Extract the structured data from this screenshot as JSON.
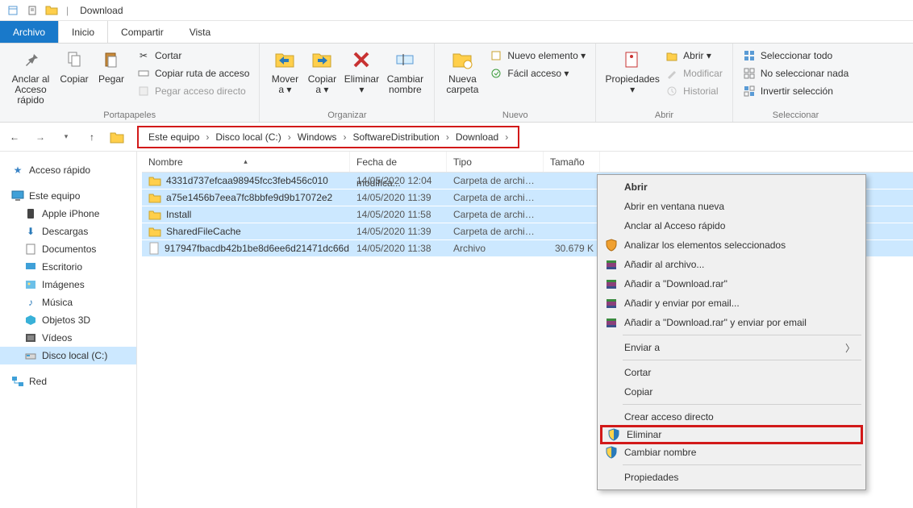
{
  "title": "Download",
  "tabs": {
    "file": "Archivo",
    "home": "Inicio",
    "share": "Compartir",
    "view": "Vista"
  },
  "ribbon": {
    "clipboard": {
      "pin": "Anclar al\nAcceso rápido",
      "copy": "Copiar",
      "paste": "Pegar",
      "cut": "Cortar",
      "copypath": "Copiar ruta de acceso",
      "pasteshortcut": "Pegar acceso directo",
      "label": "Portapapeles"
    },
    "organize": {
      "moveto": "Mover\na ▾",
      "copyto": "Copiar\na ▾",
      "delete": "Eliminar\n▾",
      "rename": "Cambiar\nnombre",
      "label": "Organizar"
    },
    "new": {
      "newfolder": "Nueva\ncarpeta",
      "newitem": "Nuevo elemento ▾",
      "easyaccess": "Fácil acceso ▾",
      "label": "Nuevo"
    },
    "open": {
      "properties": "Propiedades\n▾",
      "open": "Abrir ▾",
      "edit": "Modificar",
      "history": "Historial",
      "label": "Abrir"
    },
    "select": {
      "selectall": "Seleccionar todo",
      "selectnone": "No seleccionar nada",
      "invert": "Invertir selección",
      "label": "Seleccionar"
    }
  },
  "breadcrumb": [
    "Este equipo",
    "Disco local (C:)",
    "Windows",
    "SoftwareDistribution",
    "Download"
  ],
  "sidebar": {
    "quick": "Acceso rápido",
    "thispc": "Este equipo",
    "items": [
      "Apple iPhone",
      "Descargas",
      "Documentos",
      "Escritorio",
      "Imágenes",
      "Música",
      "Objetos 3D",
      "Vídeos",
      "Disco local (C:)"
    ],
    "network": "Red"
  },
  "columns": {
    "name": "Nombre",
    "date": "Fecha de modifica...",
    "type": "Tipo",
    "size": "Tamaño"
  },
  "rows": [
    {
      "name": "4331d737efcaa98945fcc3feb456c010",
      "date": "14/05/2020 12:04",
      "type": "Carpeta de archivos",
      "size": "",
      "kind": "folder"
    },
    {
      "name": "a75e1456b7eea7fc8bbfe9d9b17072e2",
      "date": "14/05/2020 11:39",
      "type": "Carpeta de archivos",
      "size": "",
      "kind": "folder"
    },
    {
      "name": "Install",
      "date": "14/05/2020 11:58",
      "type": "Carpeta de archivos",
      "size": "",
      "kind": "folder"
    },
    {
      "name": "SharedFileCache",
      "date": "14/05/2020 11:39",
      "type": "Carpeta de archivos",
      "size": "",
      "kind": "folder"
    },
    {
      "name": "917947fbacdb42b1be8d6ee6d21471dc66d...",
      "date": "14/05/2020 11:38",
      "type": "Archivo",
      "size": "30.679 K",
      "kind": "file"
    }
  ],
  "context": {
    "open": "Abrir",
    "opennew": "Abrir en ventana nueva",
    "pinquick": "Anclar al Acceso rápido",
    "analyze": "Analizar los elementos seleccionados",
    "addarchive": "Añadir al archivo...",
    "adddownload": "Añadir a \"Download.rar\"",
    "addemail": "Añadir y enviar por email...",
    "adddownloademail": "Añadir a \"Download.rar\" y enviar por email",
    "sendto": "Enviar a",
    "cut": "Cortar",
    "copy": "Copiar",
    "shortcut": "Crear acceso directo",
    "delete": "Eliminar",
    "rename": "Cambiar nombre",
    "properties": "Propiedades"
  }
}
